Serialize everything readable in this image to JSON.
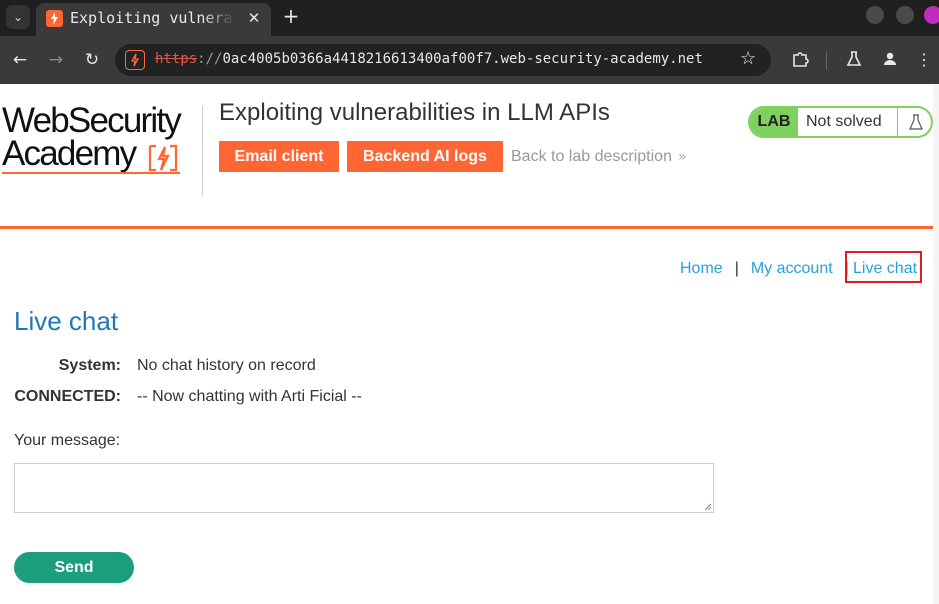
{
  "browser": {
    "tab_title": "Exploiting vulnerabilities in LLM APIs",
    "tab_close": "✕",
    "new_tab": "+",
    "url_scheme": "https",
    "url_sep": "://",
    "url_rest": "0ac4005b0366a4418216613400af00f7.web-security-academy.net",
    "url_ellipsis": "…",
    "icons": {
      "dropdown": "chevron-down-icon",
      "back": "arrow-left-icon",
      "forward": "arrow-right-icon",
      "reload": "reload-icon",
      "bookmark": "star-icon",
      "extensions": "puzzle-icon",
      "labs": "flask-icon",
      "profile": "person-icon",
      "menu": "kebab-menu-icon"
    }
  },
  "header": {
    "logo_line1": "WebSecurity",
    "logo_line2": "Academy",
    "lab_title": "Exploiting vulnerabilities in LLM APIs",
    "email_client": "Email client",
    "backend_logs": "Backend AI logs",
    "back_link": "Back to lab description",
    "back_arrows": "»",
    "status_lab": "LAB",
    "status_text": "Not solved",
    "brand_color": "#ff6633",
    "status_color": "#7fd15f"
  },
  "nav": {
    "home": "Home",
    "sep": "|",
    "my_account": "My account",
    "live_chat": "Live chat"
  },
  "chat": {
    "heading": "Live chat",
    "rows": [
      {
        "label": "System:",
        "text": "No chat history on record"
      },
      {
        "label": "CONNECTED:",
        "text": "-- Now chatting with Arti Ficial --"
      }
    ],
    "message_label": "Your message:",
    "message_value": "",
    "send": "Send",
    "send_color": "#1a9e7e"
  }
}
